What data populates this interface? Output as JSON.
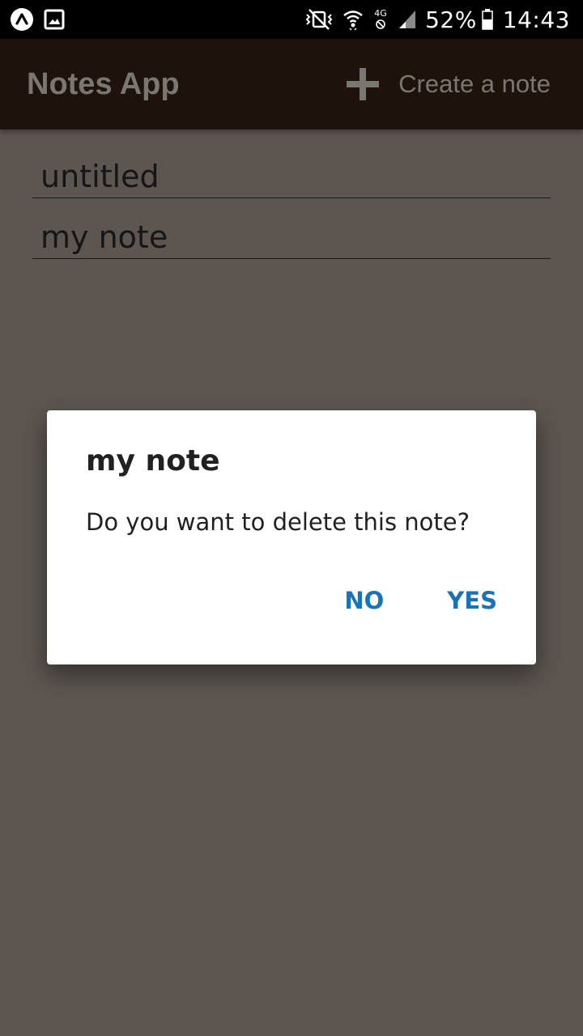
{
  "status_bar": {
    "left_icons": [
      "app-notification-icon",
      "gallery-icon"
    ],
    "right_icons": [
      "vibrate-mute-icon",
      "wifi-icon",
      "4g-icon",
      "cell-signal-icon",
      "battery-icon"
    ],
    "network_label": "4G",
    "battery": "52%",
    "time": "14:43"
  },
  "app_bar": {
    "title": "Notes App",
    "create_label": "Create a note",
    "create_icon": "plus-icon",
    "background": "#1d130b",
    "text_color": "#7a7672"
  },
  "notes": [
    {
      "title": "untitled"
    },
    {
      "title": "my note"
    }
  ],
  "dialog": {
    "title": "my note",
    "message": "Do you want to delete this note?",
    "no_label": "NO",
    "yes_label": "YES",
    "accent": "#1a73b8"
  }
}
